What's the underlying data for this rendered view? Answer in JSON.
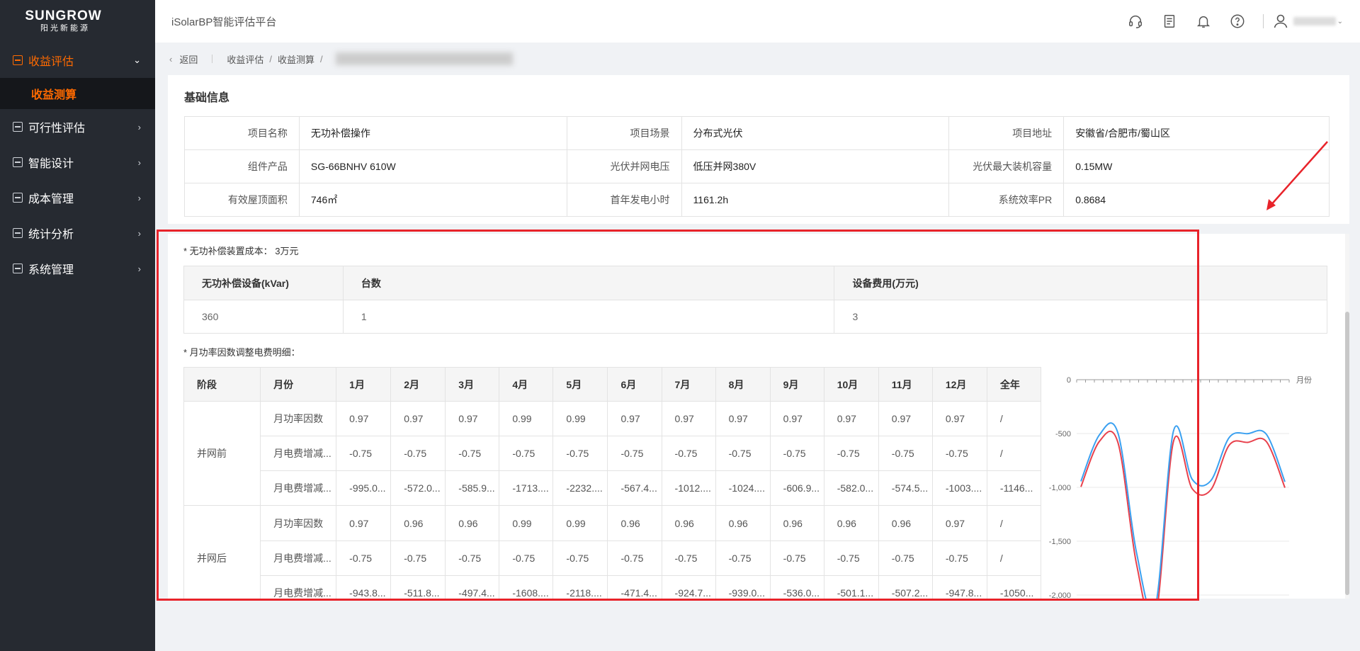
{
  "brand": {
    "name": "SUNGROW",
    "sub": "阳光新能源"
  },
  "header": {
    "app_title": "iSolarBP智能评估平台"
  },
  "sidebar": {
    "items": [
      {
        "label": "收益评估",
        "arrow": "⌄"
      },
      {
        "label": "可行性评估",
        "arrow": "›"
      },
      {
        "label": "智能设计",
        "arrow": "›"
      },
      {
        "label": "成本管理",
        "arrow": "›"
      },
      {
        "label": "统计分析",
        "arrow": "›"
      },
      {
        "label": "系统管理",
        "arrow": "›"
      }
    ],
    "sub_item": "收益测算"
  },
  "breadcrumb": {
    "back": "返回",
    "level1": "收益评估",
    "level2": "收益测算",
    "sep": "/"
  },
  "basic_info": {
    "title": "基础信息",
    "rows": [
      [
        {
          "label": "项目名称",
          "value": "无功补偿操作"
        },
        {
          "label": "项目场景",
          "value": "分布式光伏"
        },
        {
          "label": "项目地址",
          "value": "安徽省/合肥市/蜀山区"
        }
      ],
      [
        {
          "label": "组件产品",
          "value": "SG-66BNHV 610W"
        },
        {
          "label": "光伏并网电压",
          "value": "低压并网380V"
        },
        {
          "label": "光伏最大装机容量",
          "value": "0.15MW"
        }
      ],
      [
        {
          "label": "有效屋顶面积",
          "value": "746㎡"
        },
        {
          "label": "首年发电小时",
          "value": "1161.2h"
        },
        {
          "label": "系统效率PR",
          "value": "0.8684"
        }
      ]
    ]
  },
  "compensation": {
    "cost_label": "* 无功补偿装置成本：",
    "cost_value": "3万元",
    "headers": [
      "无功补偿设备(kVar)",
      "台数",
      "设备费用(万元)"
    ],
    "row": [
      "360",
      "1",
      "3"
    ]
  },
  "monthly": {
    "section_label": "* 月功率因数调整电费明细：",
    "headers": [
      "阶段",
      "月份",
      "1月",
      "2月",
      "3月",
      "4月",
      "5月",
      "6月",
      "7月",
      "8月",
      "9月",
      "10月",
      "11月",
      "12月",
      "全年"
    ],
    "groups": [
      {
        "stage": "并网前",
        "rows": [
          {
            "label": "月功率因数",
            "values": [
              "0.97",
              "0.97",
              "0.97",
              "0.99",
              "0.99",
              "0.97",
              "0.97",
              "0.97",
              "0.97",
              "0.97",
              "0.97",
              "0.97",
              "/"
            ]
          },
          {
            "label": "月电费增减...",
            "values": [
              "-0.75",
              "-0.75",
              "-0.75",
              "-0.75",
              "-0.75",
              "-0.75",
              "-0.75",
              "-0.75",
              "-0.75",
              "-0.75",
              "-0.75",
              "-0.75",
              "/"
            ]
          },
          {
            "label": "月电费增减...",
            "values": [
              "-995.0...",
              "-572.0...",
              "-585.9...",
              "-1713....",
              "-2232....",
              "-567.4...",
              "-1012....",
              "-1024....",
              "-606.9...",
              "-582.0...",
              "-574.5...",
              "-1003....",
              "-1146..."
            ]
          }
        ]
      },
      {
        "stage": "并网后",
        "rows": [
          {
            "label": "月功率因数",
            "values": [
              "0.97",
              "0.96",
              "0.96",
              "0.99",
              "0.99",
              "0.96",
              "0.96",
              "0.96",
              "0.96",
              "0.96",
              "0.96",
              "0.97",
              "/"
            ]
          },
          {
            "label": "月电费增减...",
            "values": [
              "-0.75",
              "-0.75",
              "-0.75",
              "-0.75",
              "-0.75",
              "-0.75",
              "-0.75",
              "-0.75",
              "-0.75",
              "-0.75",
              "-0.75",
              "-0.75",
              "/"
            ]
          },
          {
            "label": "月电费增减...",
            "values": [
              "-943.8...",
              "-511.8...",
              "-497.4...",
              "-1608....",
              "-2118....",
              "-471.4...",
              "-924.7...",
              "-939.0...",
              "-536.0...",
              "-501.1...",
              "-507.2...",
              "-947.8...",
              "-1050..."
            ]
          }
        ]
      }
    ]
  },
  "chart_data": {
    "type": "line",
    "x_axis_label": "月份",
    "y_ticks": [
      "0",
      "-500",
      "-1,000",
      "-1,500",
      "-2,000"
    ],
    "ylim": [
      -2150,
      0
    ],
    "x_position": "top",
    "series": [
      {
        "color": "#e8414c",
        "values": [
          -995,
          -572,
          -586,
          -1714,
          -2232,
          -567,
          -1012,
          -1024,
          -607,
          -582,
          -575,
          -1003
        ]
      },
      {
        "color": "#3aa0f0",
        "values": [
          -944,
          -512,
          -497,
          -1608,
          -2118,
          -471,
          -925,
          -939,
          -536,
          -501,
          -507,
          -948
        ]
      }
    ]
  },
  "colors": {
    "accent": "#ff6a00",
    "annotation": "#e8232a",
    "sidebar_bg": "#262a31"
  },
  "icons": [
    "headset-icon",
    "document-icon",
    "bell-icon",
    "help-icon",
    "user-icon"
  ]
}
